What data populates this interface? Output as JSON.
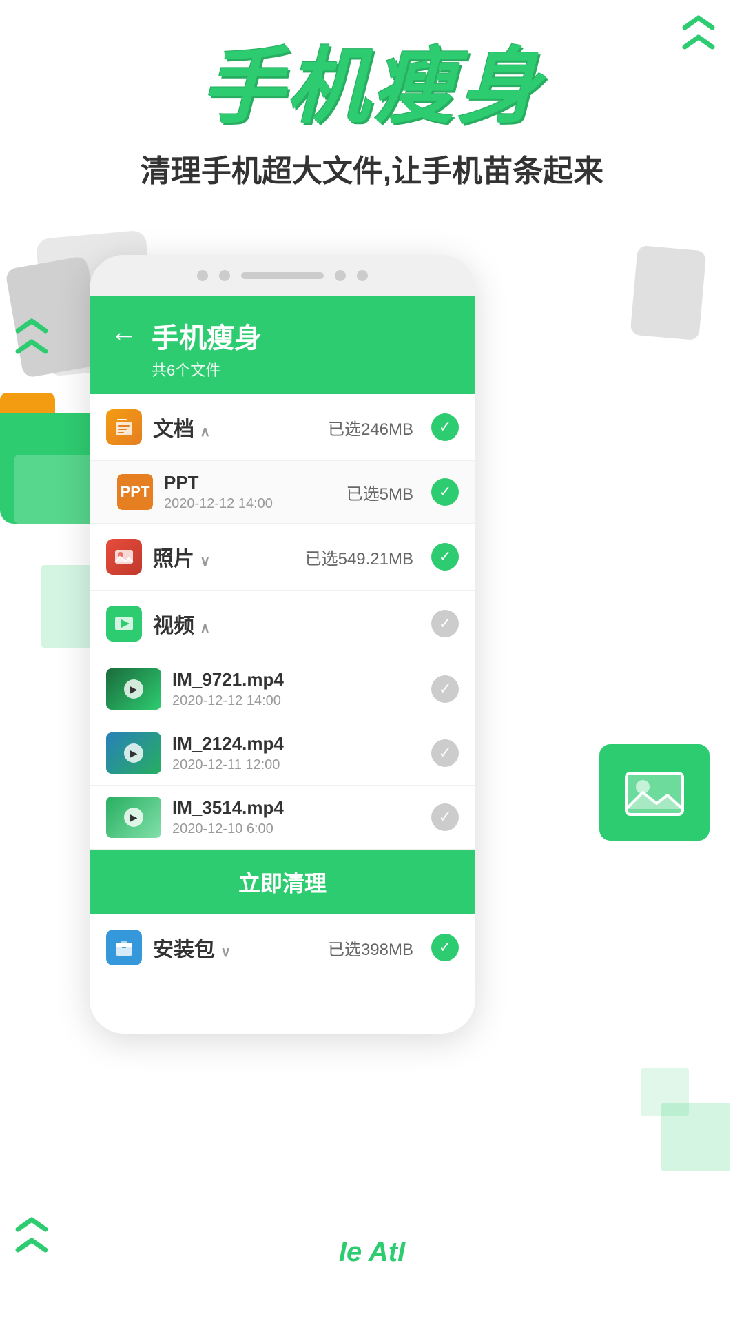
{
  "app": {
    "main_title": "手机瘦身",
    "subtitle": "清理手机超大文件,让手机苗条起来"
  },
  "header": {
    "back_label": "←",
    "title": "手机瘦身",
    "file_count": "共6个文件"
  },
  "categories": [
    {
      "id": "docs",
      "name": "文档",
      "size": "已选246MB",
      "checked": true,
      "expanded": true,
      "icon_type": "docs",
      "chevron": "∧",
      "sub_items": [
        {
          "name": "PPT",
          "date": "2020-12-12 14:00",
          "size": "已选5MB",
          "checked": true
        }
      ]
    },
    {
      "id": "photos",
      "name": "照片",
      "size": "已选549.21MB",
      "checked": true,
      "expanded": false,
      "icon_type": "photos",
      "chevron": "∨",
      "sub_items": []
    },
    {
      "id": "video",
      "name": "视频",
      "size": "",
      "checked": false,
      "expanded": true,
      "icon_type": "video",
      "chevron": "∧",
      "sub_items": [
        {
          "name": "IM_9721.mp4",
          "date": "2020-12-12 14:00",
          "checked": false,
          "thumb_class": "video-thumb-1"
        },
        {
          "name": "IM_2124.mp4",
          "date": "2020-12-11 12:00",
          "checked": false,
          "thumb_class": "video-thumb-2"
        },
        {
          "name": "IM_3514.mp4",
          "date": "2020-12-10 6:00",
          "checked": false,
          "thumb_class": "video-thumb-3"
        }
      ]
    }
  ],
  "clean_button": {
    "label": "立即清理"
  },
  "package_row": {
    "name": "安装包",
    "size": "已选398MB",
    "checked": true,
    "chevron": "∨"
  },
  "bottom_text": "Ie AtI",
  "chevrons": {
    "symbol": "≫",
    "double_up": "⟪"
  }
}
